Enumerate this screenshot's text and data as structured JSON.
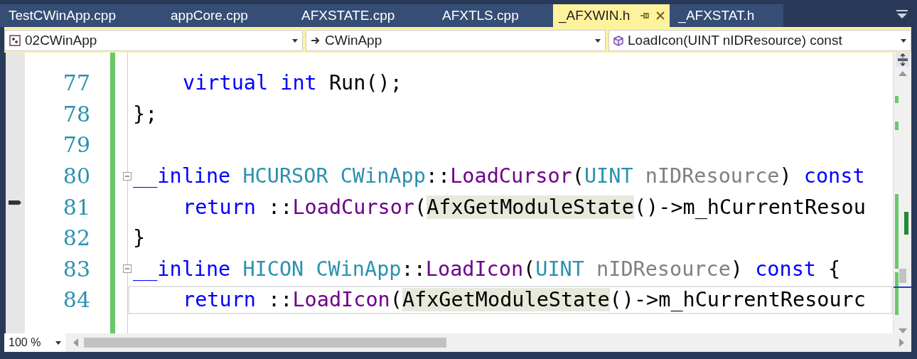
{
  "tabs": [
    {
      "label": "TestCWinApp.cpp",
      "selected": false
    },
    {
      "label": "appCore.cpp",
      "selected": false
    },
    {
      "label": "AFXSTATE.cpp",
      "selected": false
    },
    {
      "label": "AFXTLS.cpp",
      "selected": false
    },
    {
      "label": "_AFXWIN.h",
      "selected": true
    },
    {
      "label": "_AFXSTAT.h",
      "selected": false
    }
  ],
  "navigation": {
    "project": "02CWinApp",
    "scope": "CWinApp",
    "member": "LoadIcon(UINT nIDResource) const"
  },
  "code_lines": [
    {
      "number": "77",
      "indent": true,
      "fold": false,
      "current": false,
      "tokens": [
        {
          "kind": "kw",
          "text": "virtual int"
        },
        {
          "kind": "plain",
          "text": " Run();"
        }
      ]
    },
    {
      "number": "78",
      "indent": false,
      "fold": false,
      "current": false,
      "tokens": [
        {
          "kind": "plain",
          "text": "};"
        }
      ]
    },
    {
      "number": "79",
      "fold": false,
      "current": false
    },
    {
      "number": "80",
      "indent": false,
      "fold": true,
      "current": false,
      "tokens": [
        {
          "kind": "kw",
          "text": "__inline "
        },
        {
          "kind": "type",
          "text": "HCURSOR CWinApp"
        },
        {
          "kind": "plain",
          "text": "::"
        },
        {
          "kind": "fn",
          "text": "LoadCursor"
        },
        {
          "kind": "plain",
          "text": "("
        },
        {
          "kind": "type",
          "text": "UINT "
        },
        {
          "kind": "param",
          "text": "nIDResource"
        },
        {
          "kind": "plain",
          "text": ") "
        },
        {
          "kind": "kw",
          "text": "const"
        }
      ]
    },
    {
      "number": "81",
      "indent": true,
      "fold": false,
      "current": false,
      "tokens": [
        {
          "kind": "kw",
          "text": "return"
        },
        {
          "kind": "plain",
          "text": " ::"
        },
        {
          "kind": "fn",
          "text": "LoadCursor"
        },
        {
          "kind": "plain",
          "text": "("
        },
        {
          "kind": "ref",
          "text": "AfxGetModuleState"
        },
        {
          "kind": "plain",
          "text": "()->m_hCurrentResou"
        }
      ]
    },
    {
      "number": "82",
      "indent": false,
      "fold": false,
      "current": false,
      "tokens": [
        {
          "kind": "plain",
          "text": "}"
        }
      ]
    },
    {
      "number": "83",
      "indent": false,
      "fold": true,
      "current": false,
      "tokens": [
        {
          "kind": "kw",
          "text": "__inline "
        },
        {
          "kind": "type",
          "text": "HICON CWinApp"
        },
        {
          "kind": "plain",
          "text": "::"
        },
        {
          "kind": "fn",
          "text": "LoadIcon"
        },
        {
          "kind": "plain",
          "text": "("
        },
        {
          "kind": "type",
          "text": "UINT "
        },
        {
          "kind": "param",
          "text": "nIDResource"
        },
        {
          "kind": "plain",
          "text": ") "
        },
        {
          "kind": "kw",
          "text": "const"
        },
        {
          "kind": "plain",
          "text": " {"
        }
      ]
    },
    {
      "number": "84",
      "indent": true,
      "fold": false,
      "current": true,
      "tokens": [
        {
          "kind": "kw",
          "text": "return"
        },
        {
          "kind": "plain",
          "text": " ::"
        },
        {
          "kind": "fn",
          "text": "LoadIcon"
        },
        {
          "kind": "plain",
          "text": "("
        },
        {
          "kind": "ref",
          "text": "AfxGetModuleState"
        },
        {
          "kind": "plain",
          "text": "()->m_hCurrentResourc"
        }
      ]
    }
  ],
  "zoom": "100 %"
}
